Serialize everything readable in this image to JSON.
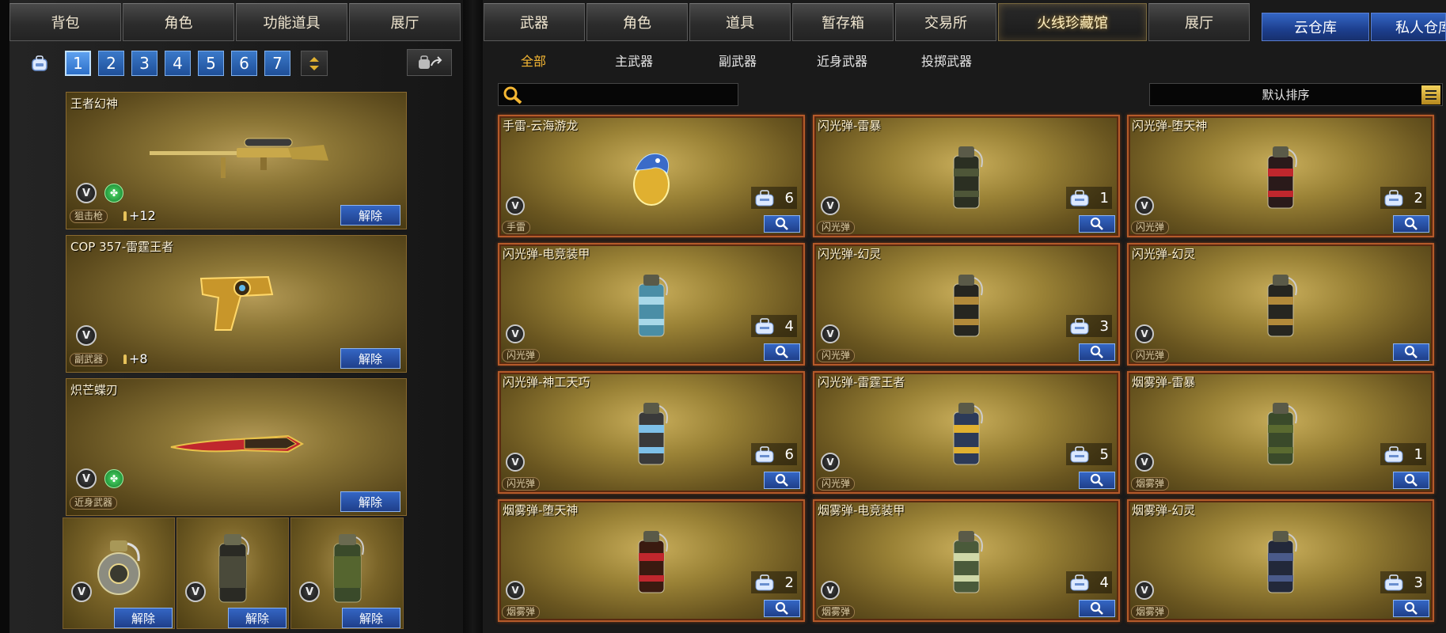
{
  "left_tabs": [
    "背包",
    "角色",
    "功能道具",
    "展厅"
  ],
  "pages": [
    "1",
    "2",
    "3",
    "4",
    "5",
    "6",
    "7"
  ],
  "active_page": "1",
  "equipped": [
    {
      "name": "王者幻神",
      "category": "狙击枪",
      "ammo": "+12",
      "has_green_badge": true,
      "release": "解除"
    },
    {
      "name": "COP 357-雷霆王者",
      "category": "副武器",
      "ammo": "+8",
      "has_green_badge": false,
      "release": "解除"
    },
    {
      "name": "炽芒蝶刃",
      "category": "近身武器",
      "has_green_badge": true,
      "release": "解除"
    }
  ],
  "grenade_slots": [
    {
      "release": "解除"
    },
    {
      "release": "解除"
    },
    {
      "release": "解除"
    }
  ],
  "right_tabs": [
    "武器",
    "角色",
    "道具",
    "暂存箱",
    "交易所",
    "火线珍藏馆",
    "展厅"
  ],
  "right_active_tab": "火线珍藏馆",
  "storage_tabs": [
    "云仓库",
    "私人仓库"
  ],
  "sub_tabs": [
    "全部",
    "主武器",
    "副武器",
    "近身武器",
    "投掷武器"
  ],
  "active_sub_tab": "全部",
  "search": {
    "placeholder": "",
    "value": ""
  },
  "sort": {
    "label": "默认排序"
  },
  "items": [
    {
      "name": "手雷-云海游龙",
      "category": "手雷",
      "count": "6"
    },
    {
      "name": "闪光弹-雷暴",
      "category": "闪光弹",
      "count": "1"
    },
    {
      "name": "闪光弹-堕天神",
      "category": "闪光弹",
      "count": "2"
    },
    {
      "name": "闪光弹-电竞装甲",
      "category": "闪光弹",
      "count": "4"
    },
    {
      "name": "闪光弹-幻灵",
      "category": "闪光弹",
      "count": "3"
    },
    {
      "name": "闪光弹-幻灵",
      "category": "闪光弹",
      "count": ""
    },
    {
      "name": "闪光弹-神工天巧",
      "category": "闪光弹",
      "count": "6"
    },
    {
      "name": "闪光弹-雷霆王者",
      "category": "闪光弹",
      "count": "5"
    },
    {
      "name": "烟雾弹-雷暴",
      "category": "烟雾弹",
      "count": "1"
    },
    {
      "name": "烟雾弹-堕天神",
      "category": "烟雾弹",
      "count": "2"
    },
    {
      "name": "烟雾弹-电竞装甲",
      "category": "烟雾弹",
      "count": "4"
    },
    {
      "name": "烟雾弹-幻灵",
      "category": "烟雾弹",
      "count": "3"
    }
  ],
  "colors": {
    "accent_gold": "#f5b733",
    "button_blue": "#3466c4",
    "card_border": "#b55a2a"
  }
}
